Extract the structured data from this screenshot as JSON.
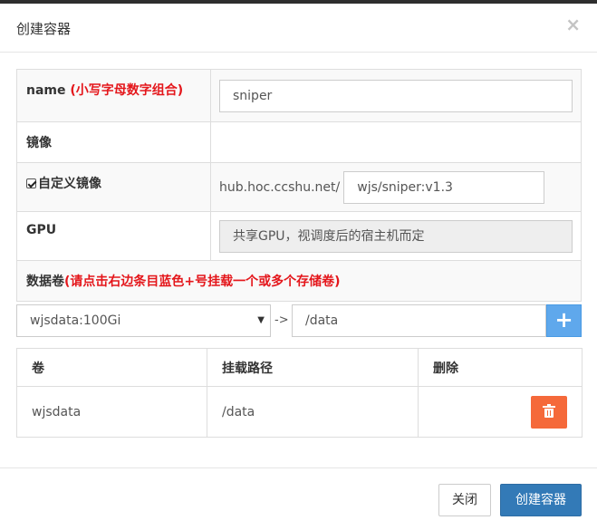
{
  "dialog": {
    "title": "创建容器",
    "close_glyph": "×"
  },
  "form": {
    "name_label": "name",
    "name_hint": "(小写字母数字组合)",
    "name_value": "sniper",
    "mirror_label": "镜像",
    "custom_mirror_label": "自定义镜像",
    "custom_mirror_checked": true,
    "registry_prefix": "hub.hoc.ccshu.net/",
    "image_value": "wjs/sniper:v1.3",
    "gpu_label": "GPU",
    "gpu_value": "共享GPU，视调度后的宿主机而定",
    "volume_label": "数据卷",
    "volume_hint": "(请点击右边条目蓝色+号挂载一个或多个存储卷)"
  },
  "mount": {
    "selected_volume": "wjsdata:100Gi",
    "arrow": "->",
    "path_value": "/data",
    "add_glyph": "+"
  },
  "volumes_table": {
    "headers": [
      "卷",
      "挂载路径",
      "删除"
    ],
    "rows": [
      {
        "volume": "wjsdata",
        "path": "/data"
      }
    ]
  },
  "footer": {
    "close_label": "关闭",
    "create_label": "创建容器"
  },
  "colors": {
    "primary": "#337ab7",
    "add": "#5fa8ec",
    "danger": "#f5693a",
    "hint_red": "#e4161b"
  }
}
